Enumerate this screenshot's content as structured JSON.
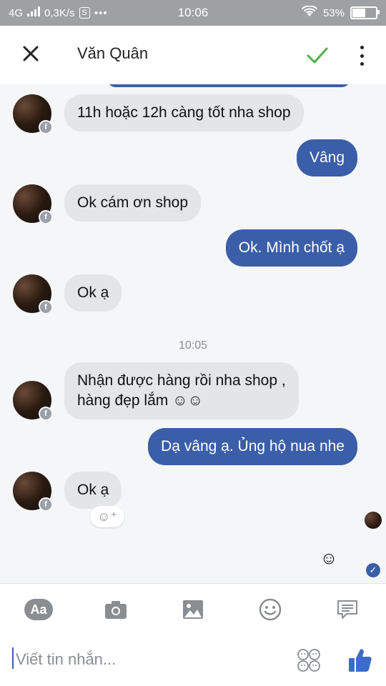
{
  "status_bar": {
    "network": "4G",
    "speed": "0,3K/s",
    "time": "10:06",
    "battery": "53%",
    "battery_level": 0.53
  },
  "header": {
    "title": "Văn Quân"
  },
  "messages": [
    {
      "text": "11h hoặc 12h càng tốt nha shop"
    },
    {
      "text": "Vâng"
    },
    {
      "text": "Ok cám ơn shop"
    },
    {
      "text": "Ok. Mình chốt ạ"
    },
    {
      "text": "Ok ạ"
    },
    {
      "text": "Nhận được hàng rồi nha shop ,",
      "text2": "hàng đẹp lắm ☺☺"
    },
    {
      "text": "Dạ vâng ạ. Ủng hộ nua nhe"
    },
    {
      "text": "Ok ạ"
    }
  ],
  "time_separator": "10:05",
  "composer": {
    "placeholder": "Viết tin nhắn..."
  },
  "toolbar": {
    "text_mode_label": "Aa"
  },
  "colors": {
    "outgoing_bubble": "#3b5ea8",
    "incoming_bubble": "#e4e5e8",
    "accent_check": "#4cae4c"
  }
}
